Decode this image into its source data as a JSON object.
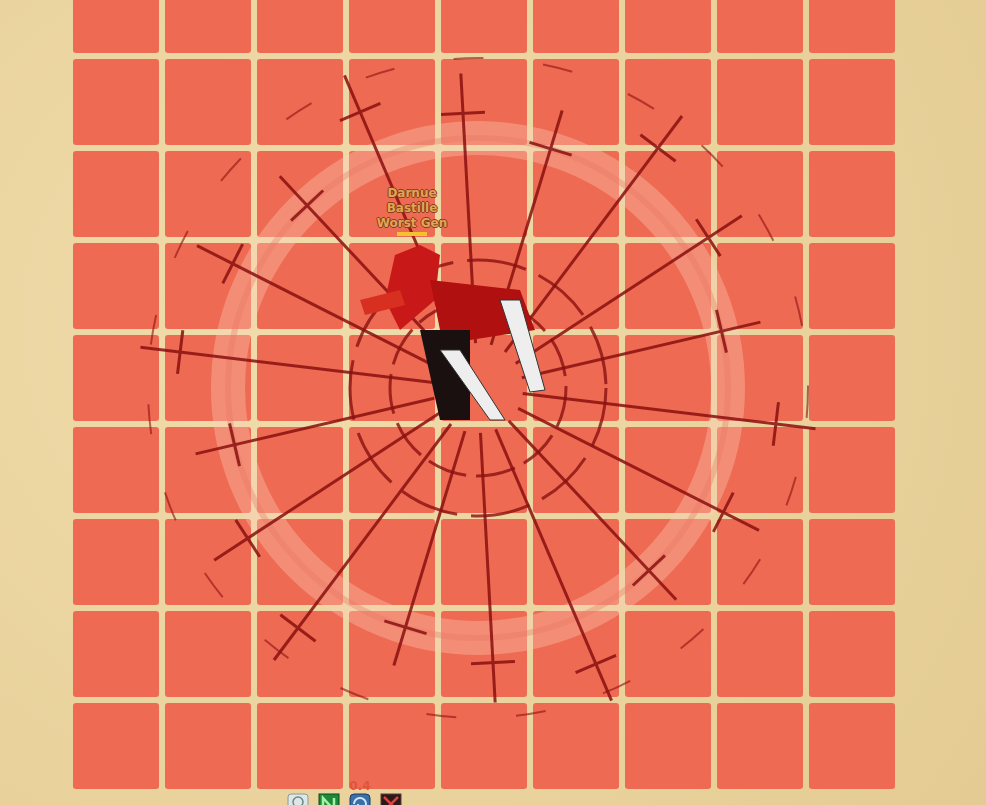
{
  "grid": {
    "rows": 9,
    "columns": 9,
    "highlighted": true
  },
  "player": {
    "name_lines": [
      "Darnue",
      "Bastille",
      "Worst Gen"
    ],
    "health": 1.0
  },
  "spell_circle": {
    "active": true
  },
  "hotbar": [
    {
      "kind": "scroll",
      "cooldown": ""
    },
    {
      "kind": "leaf",
      "cooldown": ""
    },
    {
      "kind": "swirl",
      "cooldown": "0.4"
    },
    {
      "kind": "swords",
      "cooldown": ""
    }
  ]
}
